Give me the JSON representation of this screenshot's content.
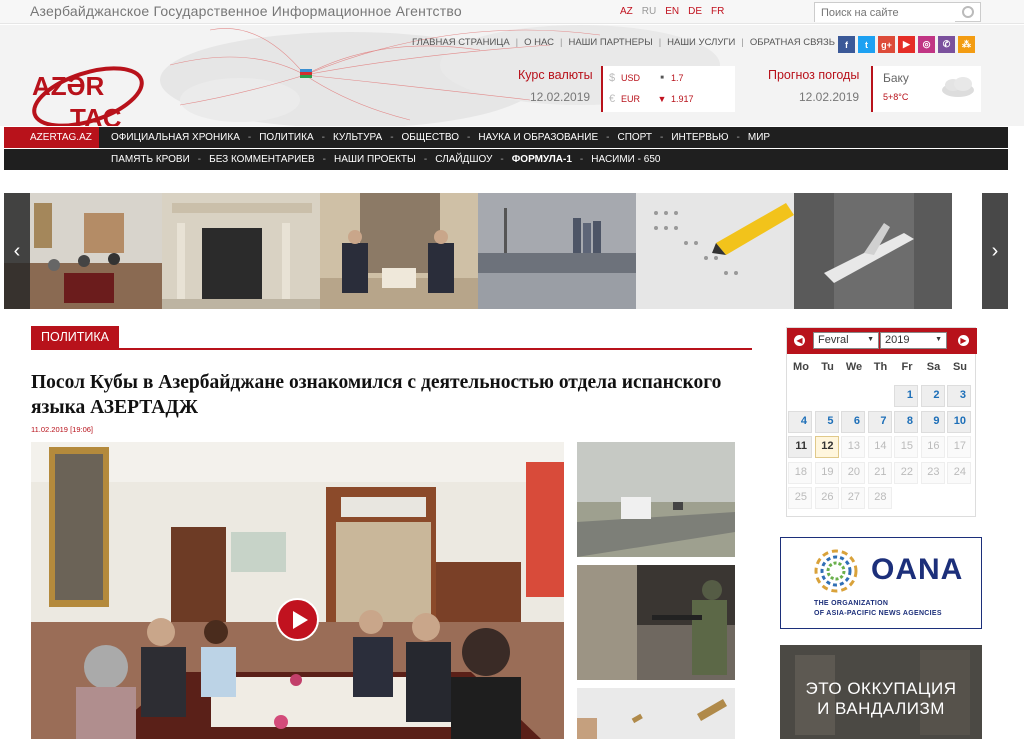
{
  "topbar": {
    "agency_name": "Азербайджанское Государственное Информационное Агентство",
    "languages": [
      "AZ",
      "RU",
      "EN",
      "DE",
      "FR"
    ],
    "search_placeholder": "Поиск на сайте"
  },
  "header": {
    "logo_line1": "AZƏR",
    "logo_line2": "TAC",
    "nav": [
      "ГЛАВНАЯ СТРАНИЦА",
      "О НАС",
      "НАШИ ПАРТНЕРЫ",
      "НАШИ УСЛУГИ",
      "ОБРАТНАЯ СВЯЗЬ"
    ],
    "social": [
      {
        "name": "facebook-icon",
        "glyph": "f",
        "color": "#3b5998"
      },
      {
        "name": "twitter-icon",
        "glyph": "t",
        "color": "#1da1f2"
      },
      {
        "name": "google-plus-icon",
        "glyph": "g+",
        "color": "#dd4b39"
      },
      {
        "name": "youtube-icon",
        "glyph": "▶",
        "color": "#e52d27"
      },
      {
        "name": "instagram-icon",
        "glyph": "◎",
        "color": "#c13584"
      },
      {
        "name": "viber-icon",
        "glyph": "✆",
        "color": "#7b519d"
      },
      {
        "name": "rss-icon",
        "glyph": "⁂",
        "color": "#f39c12"
      }
    ],
    "currency": {
      "title": "Курс валюты",
      "date": "12.02.2019",
      "rates": [
        {
          "symbol": "$",
          "code": "USD",
          "trend": "■",
          "value": "1.7"
        },
        {
          "symbol": "€",
          "code": "EUR",
          "trend": "▼",
          "value": "1.917"
        }
      ]
    },
    "weather": {
      "title": "Прогноз погоды",
      "date": "12.02.2019",
      "city": "Баку",
      "temp": "5+8°C"
    }
  },
  "nav1": {
    "home": "AZERTAG.AZ",
    "items": [
      "ОФИЦИАЛЬНАЯ ХРОНИКА",
      "ПОЛИТИКА",
      "КУЛЬТУРА",
      "ОБЩЕСТВО",
      "НАУКА И ОБРАЗОВАНИЕ",
      "СПОРТ",
      "ИНТЕРВЬЮ",
      "МИР"
    ]
  },
  "nav2": {
    "items": [
      "ПАМЯТЬ КРОВИ",
      "БЕЗ КОММЕНТАРИЕВ",
      "НАШИ ПРОЕКТЫ",
      "СЛАЙДШОУ",
      "ФОРМУЛА-1",
      "НАСИМИ - 650"
    ]
  },
  "article": {
    "section": "ПОЛИТИКА",
    "title": "Посол Кубы в Азербайджане ознакомился с деятельностью отдела испанского языка АЗЕРТАДЖ",
    "datetime": "11.02.2019 [19:06]"
  },
  "calendar": {
    "month": "Fevral",
    "year": "2019",
    "weekdays": [
      "Mo",
      "Tu",
      "We",
      "Th",
      "Fr",
      "Sa",
      "Su"
    ],
    "rows": [
      [
        "",
        "",
        "",
        "",
        "1",
        "2",
        "3"
      ],
      [
        "4",
        "5",
        "6",
        "7",
        "8",
        "9",
        "10"
      ],
      [
        "11",
        "12",
        "13",
        "14",
        "15",
        "16",
        "17"
      ],
      [
        "18",
        "19",
        "20",
        "21",
        "22",
        "23",
        "24"
      ],
      [
        "25",
        "26",
        "27",
        "28",
        "",
        "",
        ""
      ]
    ],
    "today": "12"
  },
  "banners": {
    "oana_title": "OANA",
    "oana_sub1": "THE ORGANIZATION",
    "oana_sub2": "OF ASIA-PACIFIC NEWS AGENCIES",
    "occupation_line1": "ЭТО ОККУПАЦИЯ",
    "occupation_line2": "И ВАНДАЛИЗМ"
  }
}
